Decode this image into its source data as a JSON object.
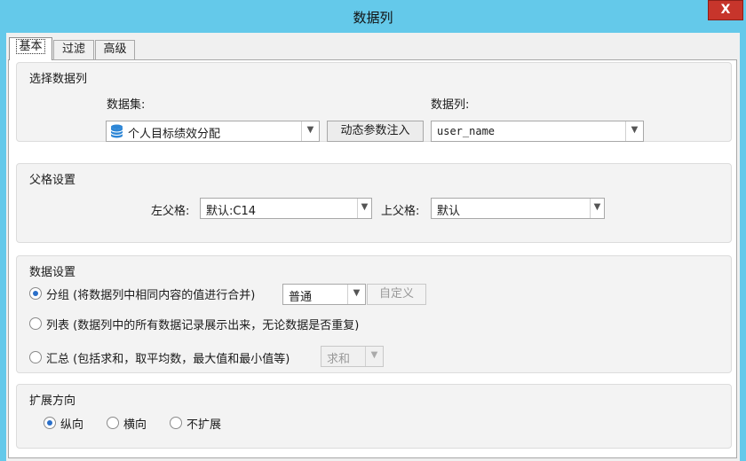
{
  "window": {
    "title": "数据列",
    "close_label": "X"
  },
  "tabs": [
    {
      "label": "基本",
      "active": true
    },
    {
      "label": "过滤",
      "active": false
    },
    {
      "label": "高级",
      "active": false
    }
  ],
  "select_column": {
    "title": "选择数据列",
    "dataset_label": "数据集:",
    "dataset_value": "个人目标绩效分配",
    "dataset_icon": "database-icon",
    "dynamic_param_button": "动态参数注入",
    "column_label": "数据列:",
    "column_value": "user_name"
  },
  "parent_settings": {
    "title": "父格设置",
    "left_parent_label": "左父格:",
    "left_parent_value": "默认:C14",
    "top_parent_label": "上父格:",
    "top_parent_value": "默认"
  },
  "data_settings": {
    "title": "数据设置",
    "group_label": "分组 (将数据列中相同内容的值进行合并)",
    "group_mode_value": "普通",
    "custom_button": "自定义",
    "list_label": "列表 (数据列中的所有数据记录展示出来，无论数据是否重复)",
    "summary_label": "汇总 (包括求和，取平均数，最大值和最小值等)",
    "summary_func_value": "求和",
    "selected": "group"
  },
  "expand_direction": {
    "title": "扩展方向",
    "options": [
      "纵向",
      "横向",
      "不扩展"
    ],
    "selected": "纵向"
  },
  "colors": {
    "titlebar": "#64c9ea",
    "close": "#c7352b",
    "radio_dot": "#2a6fc9",
    "db_icon": "#2d86d6"
  }
}
